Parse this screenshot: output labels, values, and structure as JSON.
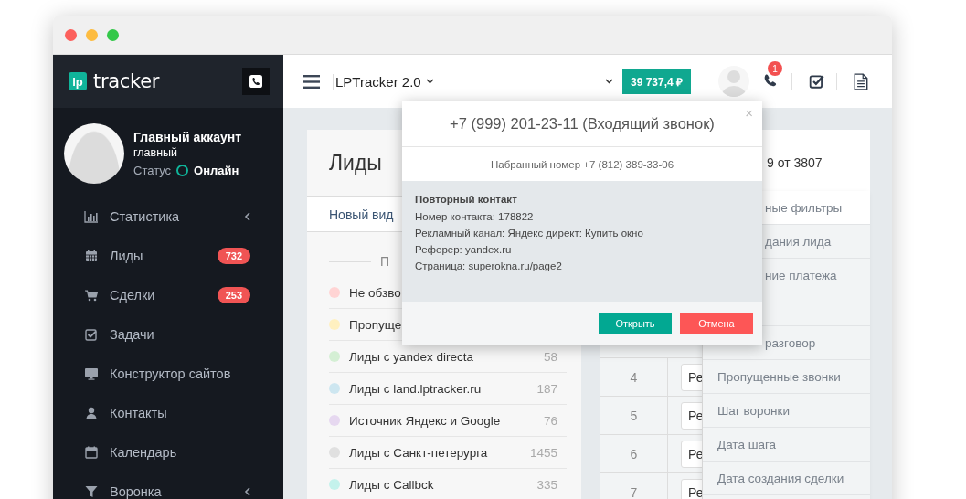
{
  "sidebar": {
    "logo": {
      "mark": "lp",
      "text": "tracker"
    },
    "profile": {
      "name": "Главный аккаунт",
      "role": "главный",
      "status_label": "Статус",
      "status": "Онлайн",
      "online": true
    },
    "items": [
      {
        "label": "Статистика",
        "expandable": true
      },
      {
        "label": "Лиды",
        "badge": "732",
        "expandable": false
      },
      {
        "label": "Сделки",
        "badge": "253",
        "expandable": false
      },
      {
        "label": "Задачи",
        "expandable": false
      },
      {
        "label": "Конструктор сайтов",
        "expandable": false
      },
      {
        "label": "Контакты",
        "expandable": false
      },
      {
        "label": "Календарь",
        "expandable": false
      },
      {
        "label": "Воронка",
        "expandable": true
      }
    ]
  },
  "header": {
    "project": "LPTracker 2.0",
    "balance": "39 737,4 ₽",
    "notifications": "1"
  },
  "leads": {
    "title": "Лиды",
    "tab": "Новый вид",
    "group_heading": "П",
    "groups": [
      {
        "label": "Не обзво",
        "color": "#ffd4d4"
      },
      {
        "label": "Пропуще",
        "color": "#fff0c0"
      },
      {
        "label": "Лиды с yandex directa",
        "count": "58",
        "color": "#d4efd4"
      },
      {
        "label": "Лиды с land.lptracker.ru",
        "count": "187",
        "color": "#cde6f0"
      },
      {
        "label": "Источник Яндекс и Google",
        "count": "76",
        "color": "#e6d8f0"
      },
      {
        "label": "Лиды с Санкт-петерурга",
        "count": "1455",
        "color": "#e0e0e0"
      },
      {
        "label": "Лиды с Callbck",
        "count": "335",
        "color": "#c4f2ec"
      }
    ]
  },
  "summary": "9 от 3807",
  "table": {
    "rows": [
      {
        "number": "4",
        "field": "Ре"
      },
      {
        "number": "5",
        "field": "Ре"
      },
      {
        "number": "6",
        "field": "Ре"
      },
      {
        "number": "7",
        "field": "Ре"
      }
    ]
  },
  "filter_menu": {
    "items": [
      {
        "label": "ные фильтры",
        "covered": true,
        "selected": true
      },
      {
        "label": "дания лида",
        "covered": true,
        "selected": false
      },
      {
        "label": "ние платежа",
        "covered": true,
        "selected": false
      },
      {
        "selected": false
      },
      {
        "label": "разговор",
        "covered": true,
        "selected": false
      },
      {
        "label": "Пропущенные звонки",
        "covered": false,
        "selected": false
      },
      {
        "label": "Шаг воронки",
        "covered": false,
        "selected": false
      },
      {
        "label": "Дата шага",
        "covered": false,
        "selected": false
      },
      {
        "label": "Дата создания сделки",
        "covered": false,
        "selected": false
      }
    ]
  },
  "call_dialog": {
    "title": "+7 (999) 201-23-11 (Входящий звонок)",
    "close": "×",
    "dialed": "Набранный номер +7 (812) 389-33-06",
    "heading": "Повторный контакт",
    "lines": [
      "Номер контакта: 178822",
      "Рекламный канал: Яндекс директ: Купить окно",
      "Реферер: yandex.ru",
      "Страница: superokna.ru/page2"
    ],
    "buttons": [
      {
        "label": "Открыть",
        "kind": "primary"
      },
      {
        "label": "Отмена",
        "kind": "danger"
      }
    ]
  }
}
